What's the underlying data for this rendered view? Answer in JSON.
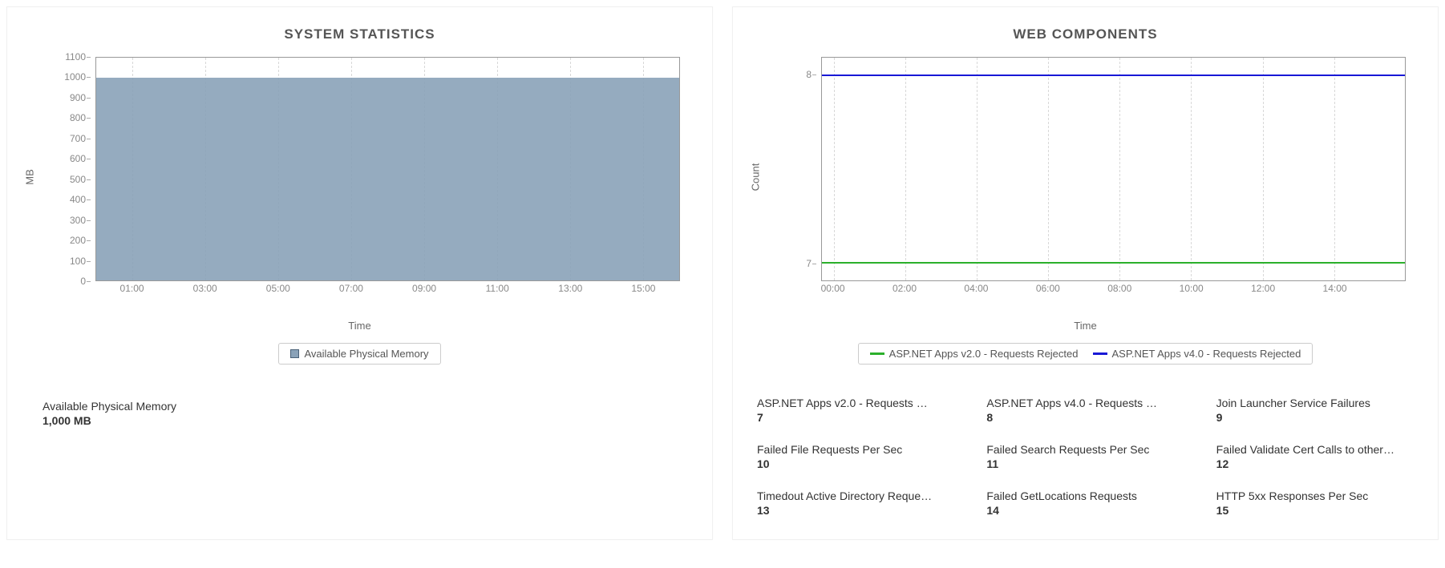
{
  "panels": {
    "left": {
      "title": "SYSTEM STATISTICS",
      "ylabel": "MB",
      "xlabel": "Time",
      "legend": "Available Physical Memory",
      "stat_label": "Available Physical Memory",
      "stat_value": "1,000 MB"
    },
    "right": {
      "title": "WEB COMPONENTS",
      "ylabel": "Count",
      "xlabel": "Time",
      "legend1": "ASP.NET Apps v2.0 - Requests Rejected",
      "legend2": "ASP.NET Apps v4.0 - Requests Rejected",
      "stats": [
        {
          "label": "ASP.NET Apps v2.0 - Requests …",
          "value": "7"
        },
        {
          "label": "ASP.NET Apps v4.0 - Requests …",
          "value": "8"
        },
        {
          "label": "Join Launcher Service Failures",
          "value": "9"
        },
        {
          "label": "Failed File Requests Per Sec",
          "value": "10"
        },
        {
          "label": "Failed Search Requests Per Sec",
          "value": "11"
        },
        {
          "label": "Failed Validate Cert Calls to other…",
          "value": "12"
        },
        {
          "label": "Timedout Active Directory Reque…",
          "value": "13"
        },
        {
          "label": "Failed GetLocations Requests",
          "value": "14"
        },
        {
          "label": "HTTP 5xx Responses Per Sec",
          "value": "15"
        }
      ]
    }
  },
  "colors": {
    "area": "#8aa2b8",
    "green": "#2bb02b",
    "blue": "#1818d6"
  },
  "chart_data": [
    {
      "type": "area",
      "title": "SYSTEM STATISTICS",
      "xlabel": "Time",
      "ylabel": "MB",
      "ylim": [
        0,
        1100
      ],
      "x_ticks": [
        "01:00",
        "03:00",
        "05:00",
        "07:00",
        "09:00",
        "11:00",
        "13:00",
        "15:00"
      ],
      "y_ticks": [
        0,
        100,
        200,
        300,
        400,
        500,
        600,
        700,
        800,
        900,
        1000,
        1100
      ],
      "series": [
        {
          "name": "Available Physical Memory",
          "constant_value": 1000,
          "color": "#8aa2b8"
        }
      ],
      "legend_position": "bottom"
    },
    {
      "type": "line",
      "title": "WEB COMPONENTS",
      "xlabel": "Time",
      "ylabel": "Count",
      "ylim": [
        7,
        8
      ],
      "x_ticks": [
        "00:00",
        "02:00",
        "04:00",
        "06:00",
        "08:00",
        "10:00",
        "12:00",
        "14:00"
      ],
      "y_ticks": [
        7,
        8
      ],
      "series": [
        {
          "name": "ASP.NET Apps v2.0 - Requests Rejected",
          "constant_value": 7,
          "color": "#2bb02b"
        },
        {
          "name": "ASP.NET Apps v4.0 - Requests Rejected",
          "constant_value": 8,
          "color": "#1818d6"
        }
      ],
      "legend_position": "bottom"
    }
  ]
}
